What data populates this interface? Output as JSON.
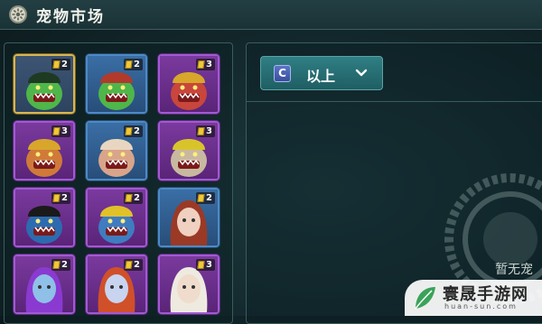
{
  "header": {
    "title": "宠物市场",
    "icon": "pet-market-icon"
  },
  "filter": {
    "grade": "C",
    "label": "以上",
    "icon": "chevron-down-icon"
  },
  "empty_text": "暂无宠",
  "watermark": {
    "name": "寰晟手游网",
    "url": "huan-sun.com"
  },
  "pets": [
    {
      "count": "2",
      "rarity": "gold",
      "pet": "green-goblin-black-helmet"
    },
    {
      "count": "2",
      "rarity": "blue",
      "pet": "green-goblin-red-helmet"
    },
    {
      "count": "3",
      "rarity": "purple",
      "pet": "red-goblin-gold-helmet"
    },
    {
      "count": "3",
      "rarity": "purple",
      "pet": "orange-goblin-gold-helmet"
    },
    {
      "count": "2",
      "rarity": "blue",
      "pet": "bandaged-dwarf"
    },
    {
      "count": "3",
      "rarity": "purple",
      "pet": "bearded-dwarf-yellow-cap"
    },
    {
      "count": "2",
      "rarity": "purple",
      "pet": "pirate-dwarf"
    },
    {
      "count": "2",
      "rarity": "purple",
      "pet": "miner-dwarf"
    },
    {
      "count": "2",
      "rarity": "blue",
      "pet": "red-haired-girl"
    },
    {
      "count": "2",
      "rarity": "purple",
      "pet": "purple-haired-girl"
    },
    {
      "count": "2",
      "rarity": "purple",
      "pet": "orange-haired-girl"
    },
    {
      "count": "3",
      "rarity": "purple",
      "pet": "white-haired-girl"
    }
  ],
  "colors": {
    "gold": "#d8b552",
    "purple": "#a15ad3",
    "blue": "#4d8ac7",
    "accent": "#2f7f84"
  }
}
